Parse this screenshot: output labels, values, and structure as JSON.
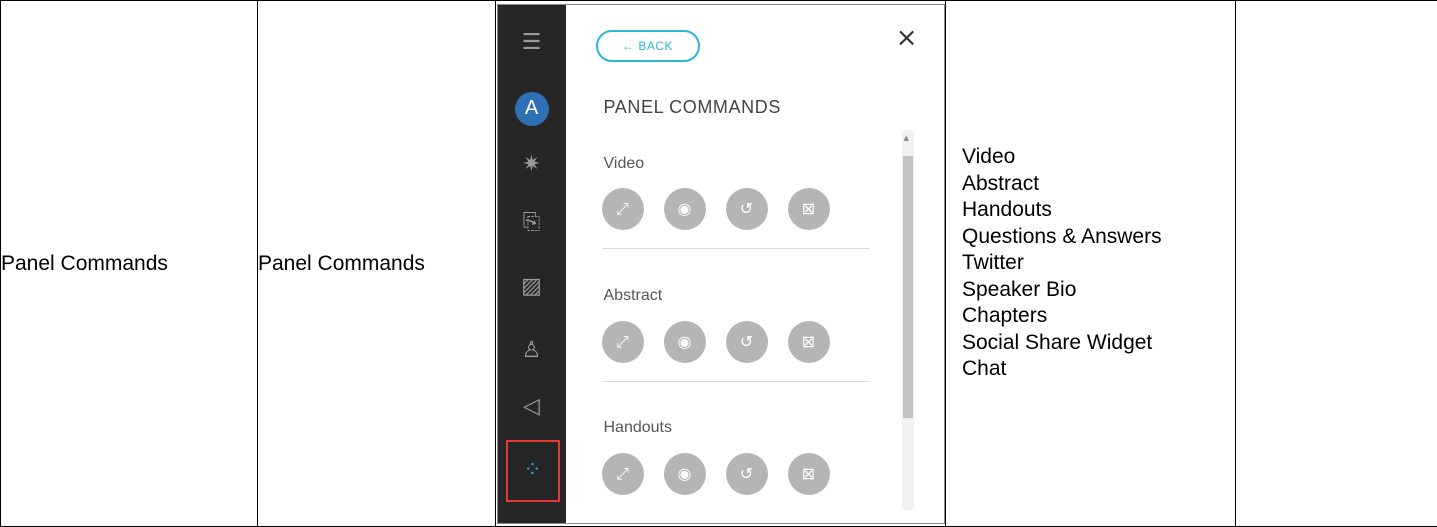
{
  "row": {
    "col1": "Panel Commands",
    "col2": "Panel Commands",
    "col4_items": [
      "Video",
      "Abstract",
      "Handouts",
      "Questions & Answers",
      "Twitter",
      "Speaker Bio",
      "Chapters",
      "Social Share Widget",
      "Chat"
    ],
    "col5": ""
  },
  "screenshot": {
    "rail": {
      "avatar_letter": "A",
      "icons": [
        "menu-icon",
        "settings-icon",
        "document-icon",
        "slides-icon",
        "speaker-icon",
        "megaphone-icon",
        "panel-commands-icon"
      ]
    },
    "back_label": "← BACK",
    "close_glyph": "×",
    "title": "PANEL COMMANDS",
    "sections": [
      {
        "label": "Video",
        "buttons": [
          "expand-icon",
          "hide-icon",
          "reset-icon",
          "close-icon"
        ]
      },
      {
        "label": "Abstract",
        "buttons": [
          "expand-icon",
          "hide-icon",
          "reset-icon",
          "close-icon"
        ]
      },
      {
        "label": "Handouts",
        "buttons": [
          "expand-icon",
          "hide-icon",
          "reset-icon",
          "close-icon"
        ]
      }
    ],
    "colors": {
      "rail_bg": "#262626",
      "accent": "#2bb5d9",
      "avatar_bg": "#2f6fb3",
      "active_border": "#e53935",
      "button_bg": "#b5b5b5"
    }
  }
}
